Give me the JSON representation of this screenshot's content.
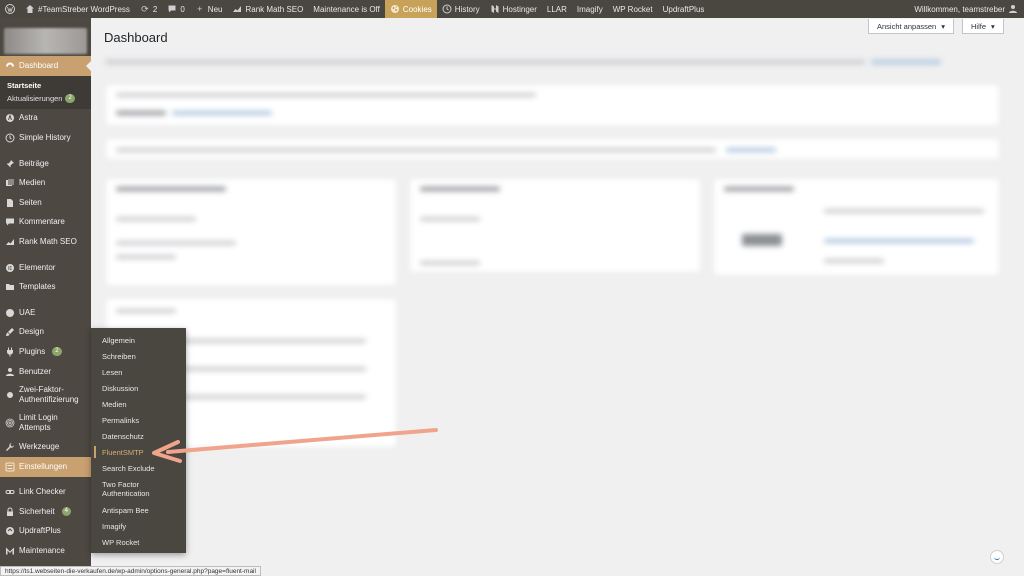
{
  "adminbar": {
    "site_name": "#TeamStreber WordPress",
    "updates_count": "2",
    "comments_count": "0",
    "new_label": "Neu",
    "rankmath_label": "Rank Math SEO",
    "maintenance_label": "Maintenance is Off",
    "cookies_label": "Cookies",
    "history_label": "History",
    "hostinger_label": "Hostinger",
    "llar_label": "LLAR",
    "imagify_label": "Imagify",
    "wprocket_label": "WP Rocket",
    "updraft_label": "UpdraftPlus",
    "welcome_label": "Willkommen, teamstreber"
  },
  "sidebar": {
    "dashboard": "Dashboard",
    "startseite": "Startseite",
    "aktualisierungen": "Aktualisierungen",
    "aktualisierungen_badge": "2",
    "astra": "Astra",
    "simple_history": "Simple History",
    "beitraege": "Beiträge",
    "medien": "Medien",
    "seiten": "Seiten",
    "kommentare": "Kommentare",
    "rankmath": "Rank Math SEO",
    "elementor": "Elementor",
    "templates": "Templates",
    "uae": "UAE",
    "design": "Design",
    "plugins": "Plugins",
    "plugins_badge": "2",
    "benutzer": "Benutzer",
    "zwei_faktor": "Zwei-Faktor-Authentifizierung",
    "limit_login": "Limit Login Attempts",
    "werkzeuge": "Werkzeuge",
    "einstellungen": "Einstellungen",
    "link_checker": "Link Checker",
    "sicherheit": "Sicherheit",
    "sicherheit_badge": "4",
    "updraftplus": "UpdraftPlus",
    "maintenance": "Maintenance"
  },
  "flyout": {
    "items": [
      "Allgemein",
      "Schreiben",
      "Lesen",
      "Diskussion",
      "Medien",
      "Permalinks",
      "Datenschutz",
      "FluentSMTP",
      "Search Exclude",
      "Two Factor Authentication",
      "Antispam Bee",
      "Imagify",
      "WP Rocket"
    ]
  },
  "main": {
    "title": "Dashboard",
    "screen_options": "Ansicht anpassen",
    "help": "Hilfe"
  },
  "status": {
    "url": "https://ts1.webseiten-die-verkaufen.de/wp-admin/options-general.php?page=fluent-mail"
  },
  "colors": {
    "adminbar": "#4a4640",
    "sidebar": "#4d4842",
    "accent": "#c9a06f",
    "arrow": "#f0a48c"
  }
}
